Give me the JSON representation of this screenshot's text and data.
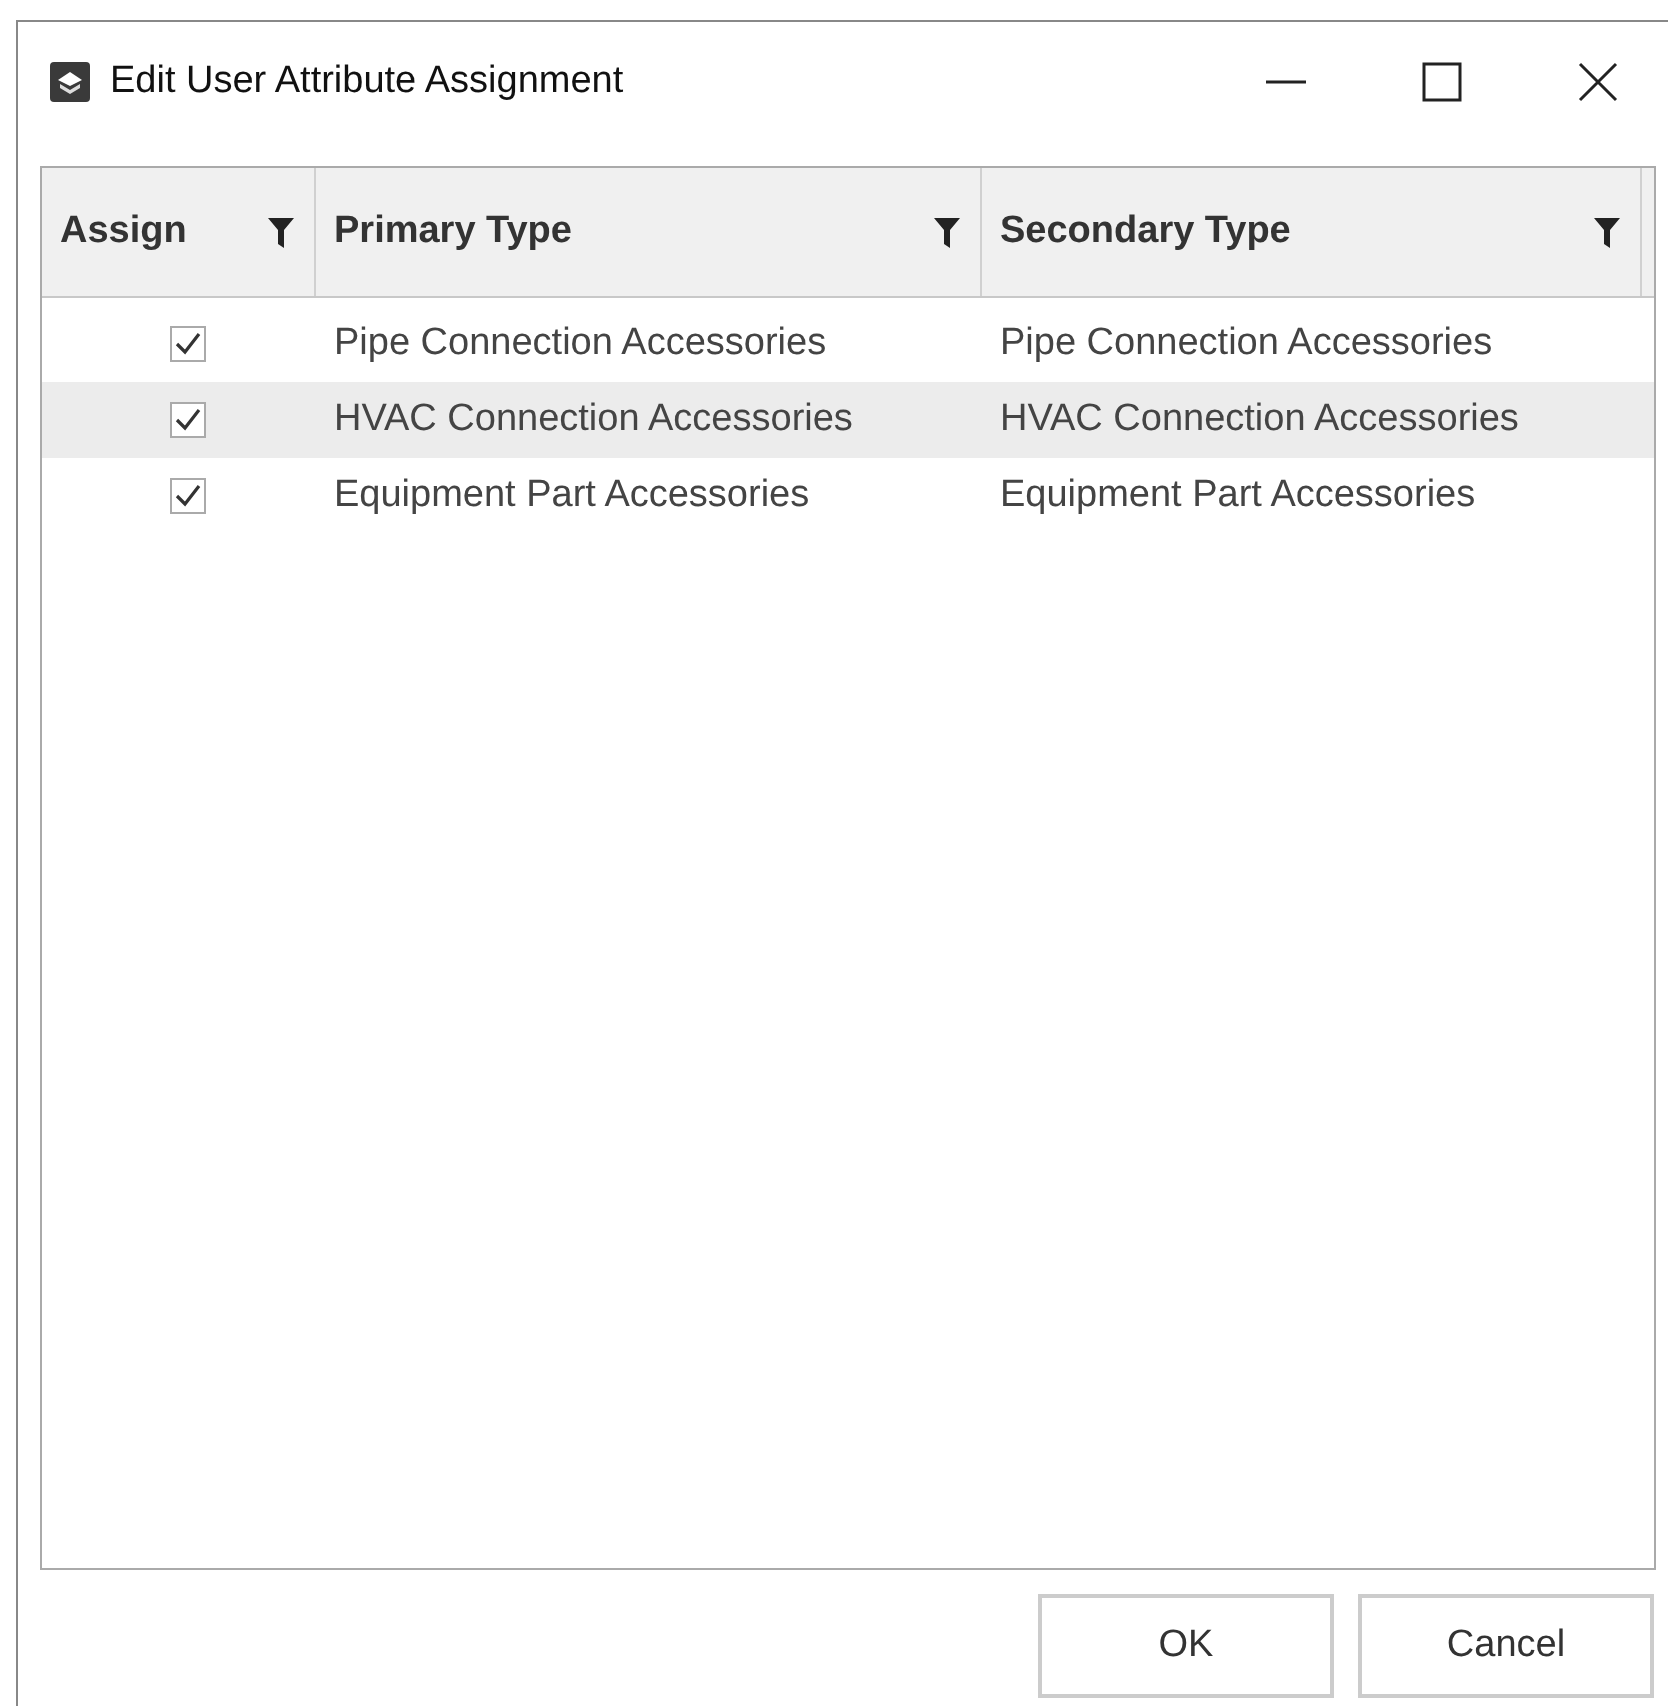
{
  "window": {
    "title": "Edit User Attribute Assignment"
  },
  "table": {
    "columns": [
      {
        "label": "Assign",
        "filter": true
      },
      {
        "label": "Primary Type",
        "filter": true
      },
      {
        "label": "Secondary Type",
        "filter": true
      }
    ],
    "rows": [
      {
        "checked": true,
        "selected": false,
        "primary": "Pipe Connection Accessories",
        "secondary": "Pipe Connection Accessories"
      },
      {
        "checked": true,
        "selected": true,
        "primary": "HVAC Connection Accessories",
        "secondary": "HVAC Connection Accessories"
      },
      {
        "checked": true,
        "selected": false,
        "primary": "Equipment Part Accessories",
        "secondary": "Equipment Part Accessories"
      }
    ]
  },
  "buttons": [
    {
      "label": "OK"
    },
    {
      "label": "Cancel"
    }
  ]
}
